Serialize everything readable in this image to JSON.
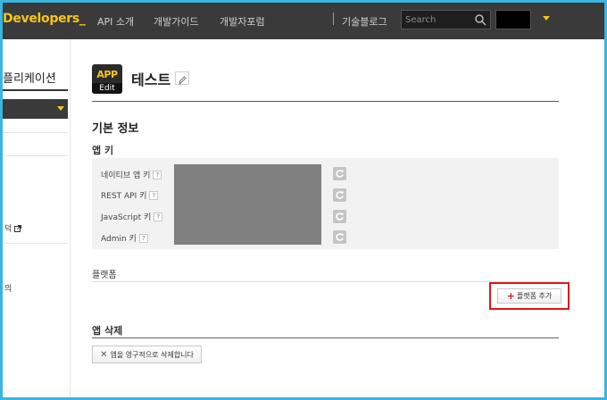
{
  "header": {
    "logo": "Developers_",
    "nav": [
      "API 소개",
      "개발가이드",
      "개발자포럼",
      "기술블로그"
    ],
    "search_placeholder": "Search",
    "colors": {
      "bar": "#3a3a3a",
      "accent": "#f5c518"
    }
  },
  "sidebar": {
    "title": "플리케이션",
    "item_external": "덕",
    "item_other": "의"
  },
  "app": {
    "icon_text": "APP",
    "icon_edit": "Edit",
    "name": "테스트"
  },
  "basic_info": {
    "heading": "기본 정보",
    "app_keys": {
      "heading": "앱 키",
      "rows": [
        {
          "label": "네이티브 앱 키"
        },
        {
          "label": "REST API 키"
        },
        {
          "label": "JavaScript 키"
        },
        {
          "label": "Admin 키"
        }
      ],
      "help": "?"
    }
  },
  "platform": {
    "heading": "플랫폼",
    "add_button": "플랫폼 추가"
  },
  "delete": {
    "heading": "앱 삭제",
    "button": "앱을 영구적으로 삭제합니다"
  }
}
